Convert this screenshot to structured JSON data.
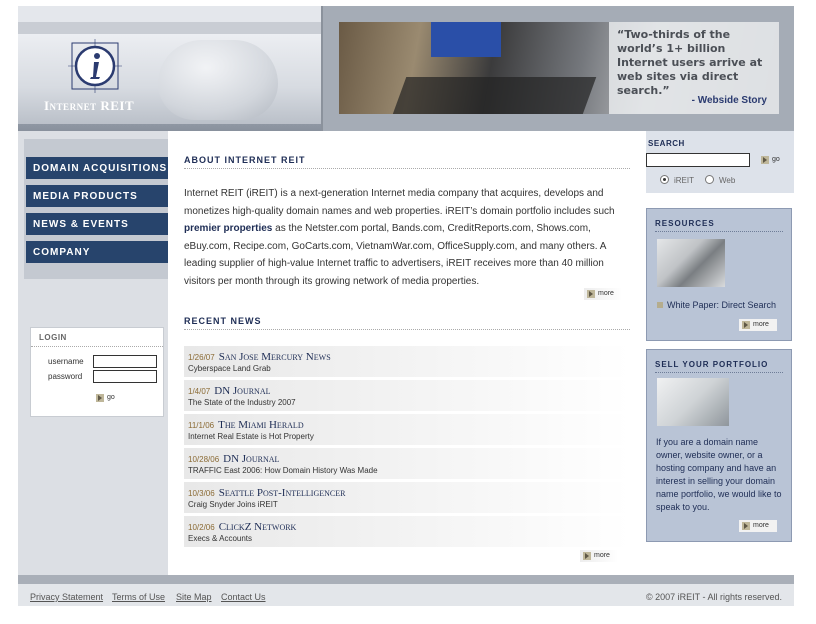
{
  "header": {
    "logo_text": "Internet REIT",
    "quote": "“Two-thirds of the world’s 1+ billion Internet users arrive at web sites via direct search.”",
    "quote_source": "- Webside Story"
  },
  "nav": {
    "items": [
      {
        "label": "DOMAIN ACQUISITIONS"
      },
      {
        "label": "MEDIA PRODUCTS"
      },
      {
        "label": "NEWS & EVENTS"
      },
      {
        "label": "COMPANY"
      }
    ]
  },
  "login": {
    "title": "LOGIN",
    "username_label": "username",
    "password_label": "password",
    "username_value": "",
    "password_value": "",
    "go_label": "go"
  },
  "about": {
    "title": "ABOUT INTERNET REIT",
    "text_before": "Internet REIT (iREIT) is a next-generation Internet media company that acquires, develops and monetizes high-quality domain names and web properties. iREIT’s domain portfolio includes such ",
    "text_emphasis": "premier properties",
    "text_after": " as the Netster.com portal, Bands.com, CreditReports.com, Shows.com, eBuy.com, Recipe.com, GoCarts.com, VietnamWar.com, OfficeSupply.com, and many others. A leading supplier of high-value Internet traffic to advertisers, iREIT receives more than 40 million visitors per month through its growing network of media properties.",
    "more_label": "more"
  },
  "news": {
    "title": "RECENT NEWS",
    "items": [
      {
        "date": "1/26/07",
        "source": "San Jose Mercury News",
        "headline": "Cyberspace Land Grab"
      },
      {
        "date": "1/4/07",
        "source": "DN Journal",
        "headline": "The State of the Industry 2007"
      },
      {
        "date": "11/1/06",
        "source": "The Miami Herald",
        "headline": "Internet Real Estate is Hot Property"
      },
      {
        "date": "10/28/06",
        "source": "DN Journal",
        "headline": "TRAFFIC East 2006: How Domain History Was Made"
      },
      {
        "date": "10/3/06",
        "source": "Seattle Post-Intelligencer",
        "headline": "Craig Snyder Joins iREIT"
      },
      {
        "date": "10/2/06",
        "source": "ClickZ Network",
        "headline": "Execs & Accounts"
      }
    ],
    "more_label": "more"
  },
  "search": {
    "title": "SEARCH",
    "value": "",
    "go_label": "go",
    "options": [
      "iREIT",
      "Web"
    ],
    "selected": "iREIT"
  },
  "resources": {
    "title": "RESOURCES",
    "link": "White Paper: Direct Search",
    "more_label": "more"
  },
  "sell": {
    "title": "SELL YOUR PORTFOLIO",
    "text": "If you are a domain name owner, website owner, or a hosting company and have an interest in selling your domain name portfolio, we would like to speak to you.",
    "more_label": "more"
  },
  "footer": {
    "links": [
      "Privacy Statement",
      "Terms of Use",
      "Site Map",
      "Contact Us"
    ],
    "copyright": "© 2007 iREIT - All rights reserved."
  }
}
